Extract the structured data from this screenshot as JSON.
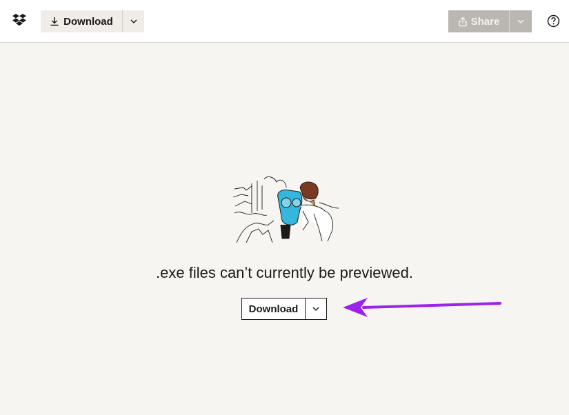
{
  "topbar": {
    "logo_icon": "dropbox-logo-icon",
    "download_label": "Download",
    "download_icon": "download-icon",
    "download_menu_icon": "chevron-down-icon",
    "share_label": "Share",
    "share_icon": "share-icon",
    "share_menu_icon": "chevron-down-icon",
    "help_icon": "help-icon"
  },
  "preview": {
    "illustration_icon": "binoculars-viewer-illustration",
    "message": ".exe files can’t currently be previewed.",
    "download_label": "Download",
    "download_menu_icon": "chevron-down-icon"
  },
  "annotation": {
    "arrow_color": "#9b23ea"
  },
  "colors": {
    "page_background": "#f7f5f2",
    "topbar_background": "#ffffff",
    "download_button_background": "#f0ede8",
    "share_button_background": "#bab6b0",
    "accent_blue": "#35b6dd"
  }
}
